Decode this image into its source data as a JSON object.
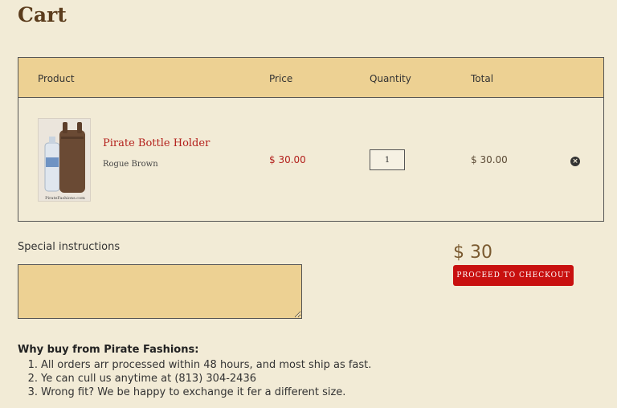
{
  "page": {
    "title": "Cart"
  },
  "cart": {
    "headers": {
      "product": "Product",
      "price": "Price",
      "quantity": "Quantity",
      "total": "Total"
    },
    "items": [
      {
        "name": "Pirate Bottle Holder",
        "variant": "Rogue Brown",
        "price": "$ 30.00",
        "quantity": "1",
        "total": "$ 30.00",
        "image_caption": "PirateFashions.com",
        "remove_icon": "close-circle-icon"
      }
    ]
  },
  "special_instructions": {
    "label": "Special instructions",
    "value": ""
  },
  "summary": {
    "subtotal": "$ 30",
    "checkout_label": "PROCEED TO CHECKOUT"
  },
  "why_buy": {
    "heading": "Why buy from Pirate Fashions:",
    "items": [
      {
        "num": "1.",
        "text": "All orders arr processed within 48 hours, and most ship as fast."
      },
      {
        "num": "2.",
        "text": "Ye can cull us anytime at (813) 304-2436"
      },
      {
        "num": "3.",
        "text": "Wrong fit? We be happy to exchange it fer a different size."
      }
    ]
  },
  "colors": {
    "background": "#f2ebd6",
    "header_fill": "#edd193",
    "accent_red": "#c8100f",
    "title_brown": "#5b3c1c"
  }
}
